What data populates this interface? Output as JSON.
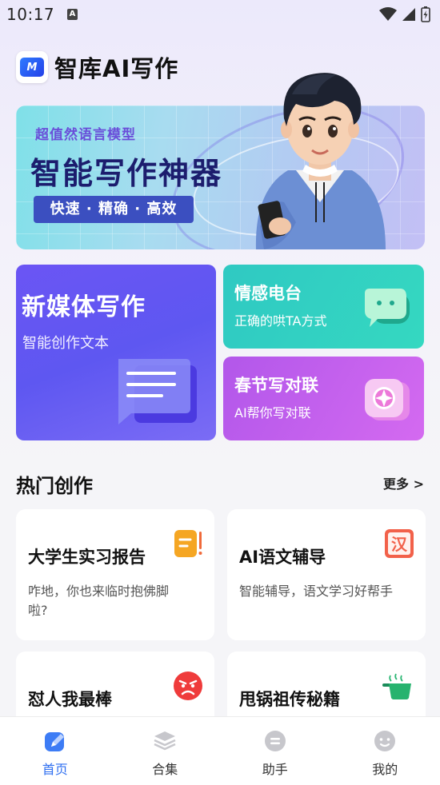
{
  "status_bar": {
    "time": "10:17",
    "a_icon": "A"
  },
  "header": {
    "logo_text": "M",
    "title": "智库AI写作"
  },
  "banner": {
    "subtitle": "超值然语言模型",
    "title": "智能写作神器",
    "tagline": "快速 · 精确 · 高效"
  },
  "features": {
    "media": {
      "title": "新媒体写作",
      "subtitle": "智能创作文本"
    },
    "emotion": {
      "title": "情感电台",
      "subtitle": "正确的哄TA方式"
    },
    "spring": {
      "title": "春节写对联",
      "subtitle": "AI帮你写对联"
    }
  },
  "section": {
    "title": "热门创作",
    "more": "更多 >"
  },
  "items": [
    {
      "title": "大学生实习报告",
      "desc": "咋地，你也来临时抱佛脚啦?",
      "icon": "report-icon"
    },
    {
      "title": "AI语文辅导",
      "desc": "智能辅导，语文学习好帮手",
      "icon": "han-char-icon"
    },
    {
      "title": "怼人我最棒",
      "desc": "",
      "icon": "angry-face-icon"
    },
    {
      "title": "甩锅祖传秘籍",
      "desc": "",
      "icon": "pot-icon"
    }
  ],
  "nav": [
    {
      "label": "首页",
      "icon": "home-edit-icon",
      "active": true
    },
    {
      "label": "合集",
      "icon": "layers-icon",
      "active": false
    },
    {
      "label": "助手",
      "icon": "assistant-icon",
      "active": false
    },
    {
      "label": "我的",
      "icon": "profile-icon",
      "active": false
    }
  ],
  "colors": {
    "accent": "#2f6ff0",
    "media_card": "#5e57f1",
    "emotion_card": "#35d8c1",
    "spring_card": "#c862ee"
  }
}
